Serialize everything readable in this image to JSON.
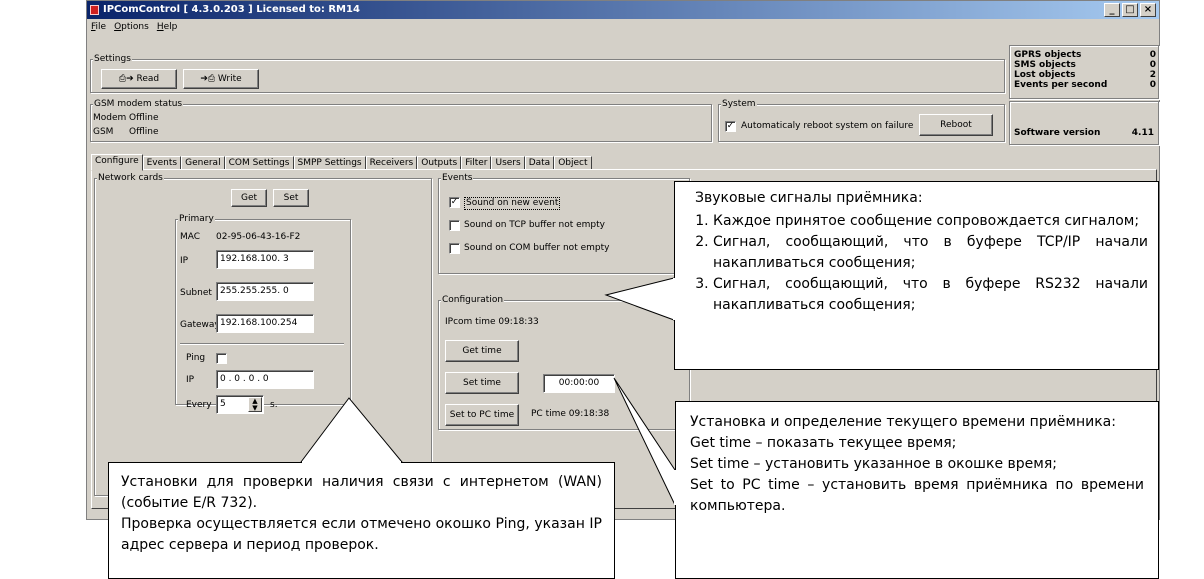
{
  "window": {
    "title": "IPComControl [ 4.3.0.203 ]   Licensed to: RM14",
    "buttons": [
      "_",
      "□",
      "×"
    ]
  },
  "menu": [
    "File",
    "Options",
    "Help"
  ],
  "settings": {
    "label": "Settings",
    "read": "Read",
    "write": "Write"
  },
  "stats": {
    "gprs_label": "GPRS objects",
    "gprs_value": "0",
    "sms_label": "SMS objects",
    "sms_value": "0",
    "lost_label": "Lost objects",
    "lost_value": "2",
    "eps_label": "Events per second",
    "eps_value": "0",
    "sw_label": "Software version",
    "sw_value": "4.11"
  },
  "gsm": {
    "label": "GSM modem status",
    "modem_label": "Modem",
    "modem_value": "Offline",
    "gsm_label": "GSM",
    "gsm_value": "Offline"
  },
  "system": {
    "label": "System",
    "auto_reboot": "Automaticaly reboot system on failure",
    "reboot": "Reboot"
  },
  "tabs": [
    "Configure",
    "Events",
    "General",
    "COM Settings",
    "SMPP Settings",
    "Receivers",
    "Outputs",
    "Filter",
    "Users",
    "Data",
    "Object"
  ],
  "network": {
    "label": "Network cards",
    "get": "Get",
    "set": "Set",
    "primary": "Primary",
    "mac_label": "MAC",
    "mac_value": "02-95-06-43-16-F2",
    "ip_label": "IP",
    "ip_value": "192.168.100. 3",
    "subnet_label": "Subnet",
    "subnet_value": "255.255.255. 0",
    "gateway_label": "Gateway",
    "gateway_value": "192.168.100.254",
    "ping_label": "Ping",
    "ping_ip_label": "IP",
    "ping_ip_value": " 0 . 0 . 0 . 0",
    "every_label": "Every",
    "every_value": "5",
    "every_unit": "s."
  },
  "events": {
    "label": "Events",
    "sound_new": "Sound on new event",
    "sound_tcp": "Sound on TCP buffer not empty",
    "sound_com": "Sound on COM buffer not empty"
  },
  "configuration": {
    "label": "Configuration",
    "ipcom_time": "IPcom time  09:18:33",
    "get_time": "Get time",
    "set_time": "Set time",
    "time_value": "00:00:00",
    "set_pc_time": "Set to PC time",
    "pc_time": "PC time  09:18:38"
  },
  "callouts": {
    "sounds_title": "Звуковые сигналы приёмника:",
    "sounds_items": [
      "Каждое принятое сообщение сопровождается сигналом;",
      "Сигнал, сообщающий, что в буфере TCP/IP начали накапливаться сообщения;",
      "Сигнал, сообщающий, что в буфере RS232 начали накапливаться сообщения;"
    ],
    "time_title": "Установка и определение текущего времени приёмника:",
    "time_lines": [
      "Get time – показать текущее время;",
      "Set time – установить указанное в окошке время;",
      "Set to PC time – установить время приёмника по времени компьютера."
    ],
    "wan_lines": [
      "Установки для проверки наличия связи с интернетом (WAN) (событие E/R 732).",
      "Проверка осуществляется если отмечено окошко Ping, указан IP адрес сервера и период проверок."
    ]
  }
}
